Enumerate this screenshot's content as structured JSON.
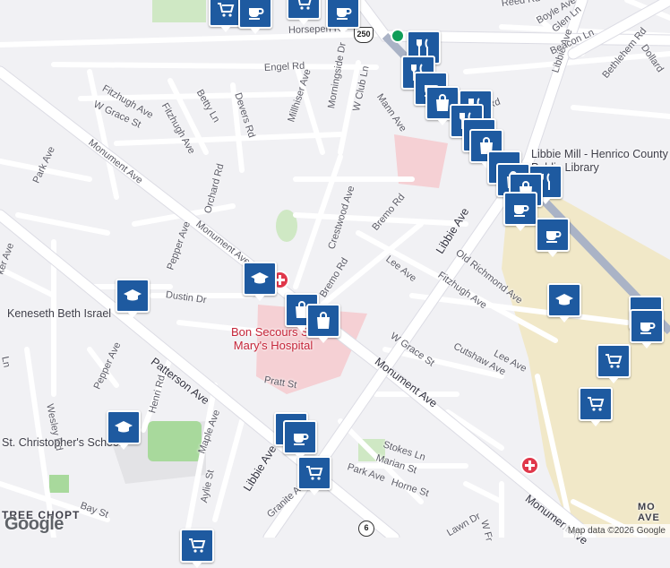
{
  "streets": [
    {
      "id": "horsepen",
      "text": "Horsepen Rd"
    },
    {
      "id": "engel",
      "text": "Engel Rd"
    },
    {
      "id": "fitzhugh1",
      "text": "Fitzhugh Ave"
    },
    {
      "id": "fitzhugh2",
      "text": "Fitzhugh Ave"
    },
    {
      "id": "betty",
      "text": "Betty Ln"
    },
    {
      "id": "devers",
      "text": "Devers Rd"
    },
    {
      "id": "millhiser",
      "text": "Millhiser Ave"
    },
    {
      "id": "morningside",
      "text": "Morningside Dr"
    },
    {
      "id": "wclub",
      "text": "W Club Ln"
    },
    {
      "id": "mann",
      "text": "Mann Ave"
    },
    {
      "id": "wgrace1",
      "text": "W Grace St"
    },
    {
      "id": "monument1",
      "text": "Monument Ave"
    },
    {
      "id": "parkave1",
      "text": "Park Ave"
    },
    {
      "id": "orchard",
      "text": "Orchard Rd"
    },
    {
      "id": "monument2",
      "text": "Monument Ave"
    },
    {
      "id": "pepper1",
      "text": "Pepper Ave"
    },
    {
      "id": "dustin",
      "text": "Dustin Dr"
    },
    {
      "id": "cleaker",
      "text": "ker Ave"
    },
    {
      "id": "crestwood",
      "text": "Crestwood Ave"
    },
    {
      "id": "bremo1",
      "text": "Bremo Rd"
    },
    {
      "id": "bremo2",
      "text": "Bremo Rd"
    },
    {
      "id": "leeave1",
      "text": "Lee Ave"
    },
    {
      "id": "libbie1",
      "text": "Libbie Ave"
    },
    {
      "id": "oldrichmond",
      "text": "Old Richmond Ave"
    },
    {
      "id": "fitzhugh3",
      "text": "Fitzhugh Ave"
    },
    {
      "id": "wgrace2",
      "text": "W Grace St"
    },
    {
      "id": "cutshaw",
      "text": "Cutshaw Ave"
    },
    {
      "id": "leeave2",
      "text": "Lee Ave"
    },
    {
      "id": "monument3",
      "text": "Monument Ave"
    },
    {
      "id": "patterson",
      "text": "Patterson Ave"
    },
    {
      "id": "pepper2",
      "text": "Pepper Ave"
    },
    {
      "id": "pratt",
      "text": "Pratt St"
    },
    {
      "id": "henri",
      "text": "Henri Rd"
    },
    {
      "id": "maple",
      "text": "Maple Ave"
    },
    {
      "id": "wesley",
      "text": "Wesley Rd"
    },
    {
      "id": "ln",
      "text": "Ln"
    },
    {
      "id": "libbie2",
      "text": "Libbie Ave"
    },
    {
      "id": "aylie",
      "text": "Aylie St"
    },
    {
      "id": "granite",
      "text": "Granite Ave"
    },
    {
      "id": "bayst",
      "text": "Bay St"
    },
    {
      "id": "stokes",
      "text": "Stokes Ln"
    },
    {
      "id": "marian",
      "text": "Marian St"
    },
    {
      "id": "parkave2",
      "text": "Park Ave"
    },
    {
      "id": "horne",
      "text": "Horne St"
    },
    {
      "id": "monument4",
      "text": "Monument Ave"
    },
    {
      "id": "lawn",
      "text": "Lawn Dr"
    },
    {
      "id": "wfr",
      "text": "W Fr"
    },
    {
      "id": "libbieave_ne",
      "text": "Libbie Ave"
    },
    {
      "id": "bethlehem",
      "text": "Bethlehem Rd"
    },
    {
      "id": "boyle",
      "text": "Boyle Ave"
    },
    {
      "id": "reed",
      "text": "Reed Rd"
    },
    {
      "id": "glen",
      "text": "Glen Ln"
    },
    {
      "id": "beacon",
      "text": "Beacon Ln"
    },
    {
      "id": "dollard",
      "text": "Dollard"
    },
    {
      "id": "rd",
      "text": "Rd"
    }
  ],
  "places": {
    "library": "Libbie Mill - Henrico County Public Library",
    "hospital": "Bon Secours St. Mary's Hospital",
    "synagogue": "Keneseth Beth Israel",
    "school": "St. Christopher's School",
    "chopt": "TREE CHOPT",
    "mcave": "MO AVE"
  },
  "shields": {
    "us250": "250",
    "sr6": "6"
  },
  "pois": [
    {
      "icon": "shopping-cart-icon",
      "name": "poi-shopping"
    },
    {
      "icon": "coffee-cup-icon",
      "name": "poi-cafe"
    },
    {
      "icon": "shopping-cart-icon",
      "name": "poi-shopping"
    },
    {
      "icon": "coffee-cup-icon",
      "name": "poi-cafe"
    },
    {
      "icon": "restaurant-icon",
      "name": "poi-restaurant"
    },
    {
      "icon": "shopping-bag-icon",
      "name": "poi-store"
    },
    {
      "icon": "graduation-cap-icon",
      "name": "poi-school"
    },
    {
      "icon": "coffee-cup-icon",
      "name": "poi-cafe"
    },
    {
      "icon": "shopping-cart-icon",
      "name": "poi-shopping"
    }
  ],
  "logo": "Google",
  "attribution": "Map data ©2026 Google",
  "colors": {
    "poi": "#1e5aa0",
    "hospital": "#e0384b",
    "rail": "#aab3c6",
    "commercial": "#f1e8c8",
    "park": "#cfe8c4"
  }
}
